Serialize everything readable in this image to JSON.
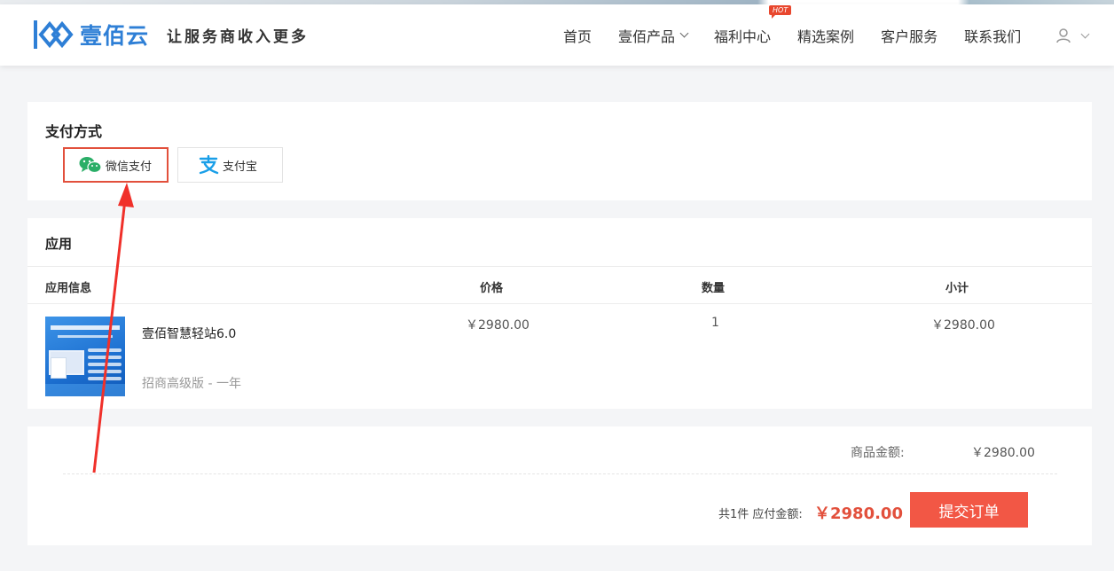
{
  "header": {
    "brand": "壹佰云",
    "slogan": "让服务商收入更多",
    "nav": [
      {
        "label": "首页"
      },
      {
        "label": "壹佰产品"
      },
      {
        "label": "福利中心",
        "badge": "HOT"
      },
      {
        "label": "精选案例"
      },
      {
        "label": "客户服务"
      },
      {
        "label": "联系我们"
      }
    ]
  },
  "payment": {
    "title": "支付方式",
    "options": [
      {
        "label": "微信支付",
        "icon": "wechat-icon",
        "selected": true
      },
      {
        "label": "支付宝",
        "icon": "alipay-icon",
        "selected": false
      }
    ]
  },
  "app": {
    "title": "应用",
    "columns": [
      "应用信息",
      "价格",
      "数量",
      "小计"
    ],
    "item": {
      "name": "壹佰智慧轻站6.0",
      "edition": "招商高级版 - 一年",
      "price": "￥2980.00",
      "quantity": "1",
      "subtotal": "￥2980.00"
    }
  },
  "summary": {
    "goods_label": "商品金额:",
    "goods_value": "￥2980.00",
    "count_text": "共1件 应付金额:",
    "total": "￥2980.00",
    "submit_label": "提交订单"
  },
  "colors": {
    "accent": "#e2503c",
    "brand": "#2e7fd6",
    "wechat": "#2aae67",
    "alipay": "#1a9fe8"
  }
}
